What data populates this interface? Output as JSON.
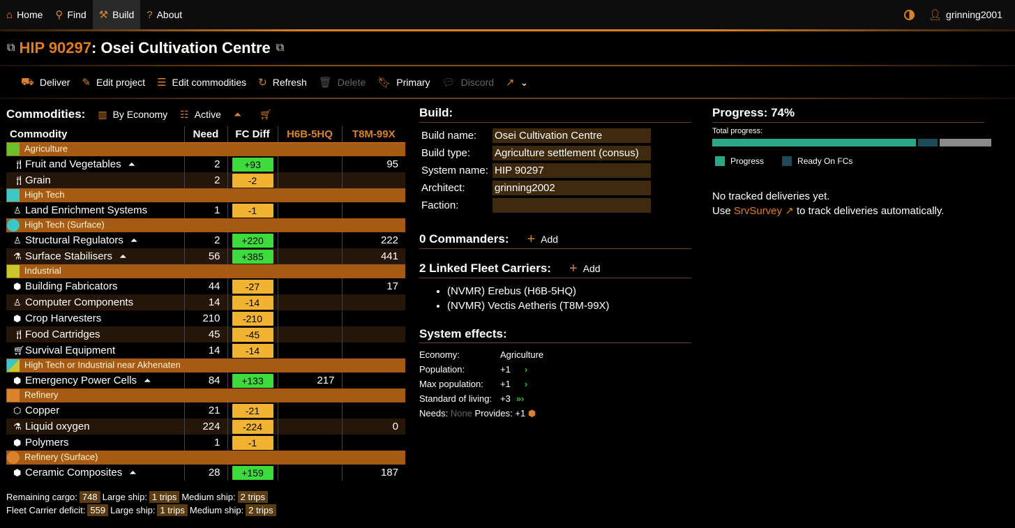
{
  "nav": {
    "items": [
      {
        "label": "Home",
        "icon": "home-icon",
        "glyph": "⌂",
        "active": false
      },
      {
        "label": "Find",
        "icon": "search-icon",
        "glyph": "⚲",
        "active": false
      },
      {
        "label": "Build",
        "icon": "build-icon",
        "glyph": "⚒",
        "active": true
      },
      {
        "label": "About",
        "icon": "question-icon",
        "glyph": "?",
        "active": false
      }
    ],
    "user": "grinning2001"
  },
  "title": {
    "system": "HIP 90297",
    "sep": ": ",
    "name": "Osei Cultivation Centre"
  },
  "toolbar": {
    "deliver": "Deliver",
    "edit_project": "Edit project",
    "edit_commodities": "Edit commodities",
    "refresh": "Refresh",
    "delete": "Delete",
    "primary": "Primary",
    "discord": "Discord"
  },
  "commodities": {
    "title": "Commodities:",
    "by_economy": "By Economy",
    "active": "Active",
    "columns": {
      "name": "Commodity",
      "need": "Need",
      "diff": "FC Diff",
      "fc1": "H6B-5HQ",
      "fc2": "T8M-99X"
    },
    "colors": {
      "positive": "#3ddc3d",
      "negative": "#f2b232",
      "group": "#a65a14"
    }
  },
  "footer": {
    "remaining_label": "Remaining cargo:",
    "remaining": "748",
    "large_label": "Large ship:",
    "remaining_large": "1 trips",
    "medium_label": "Medium ship:",
    "remaining_medium": "2 trips",
    "deficit_label": "Fleet Carrier deficit:",
    "deficit": "559",
    "deficit_large": "1 trips",
    "deficit_medium": "2 trips"
  },
  "build": {
    "title": "Build:",
    "fields": {
      "build_name_label": "Build name:",
      "build_name": "Osei Cultivation Centre",
      "build_type_label": "Build type:",
      "build_type": "Agriculture settlement (consus)",
      "system_name_label": "System name:",
      "system_name": "HIP 90297",
      "architect_label": "Architect:",
      "architect": "grinning2002",
      "faction_label": "Faction:",
      "faction": ""
    },
    "commanders_title": "0 Commanders:",
    "add_label": "Add",
    "carriers_title": "2 Linked Fleet Carriers:",
    "carriers": [
      "(NVMR) Erebus (H6B-5HQ)",
      "(NVMR) Vectis Aetheris (T8M-99X)"
    ],
    "effects_title": "System effects:",
    "effects": {
      "economy_label": "Economy:",
      "economy": "Agriculture",
      "population_label": "Population:",
      "population": "+1",
      "max_population_label": "Max population:",
      "max_population": "+1",
      "standard_label": "Standard of living:",
      "standard": "+3",
      "needs_label": "Needs:",
      "needs": "None",
      "provides_label": "Provides:",
      "provides": "+1"
    }
  },
  "progress": {
    "title": "Progress: 74%",
    "total_label": "Total progress:",
    "progress_fraction": 0.74,
    "ready_fraction": 0.07,
    "legend_progress": "Progress",
    "legend_ready": "Ready On FCs",
    "colors": {
      "progress": "#2aa887",
      "ready": "#1d4b5a",
      "remaining": "#8a8a8a"
    },
    "note1": "No tracked deliveries yet.",
    "note2_pre": "Use ",
    "note2_link": "SrvSurvey",
    "note2_post": " to track deliveries automatically."
  }
}
